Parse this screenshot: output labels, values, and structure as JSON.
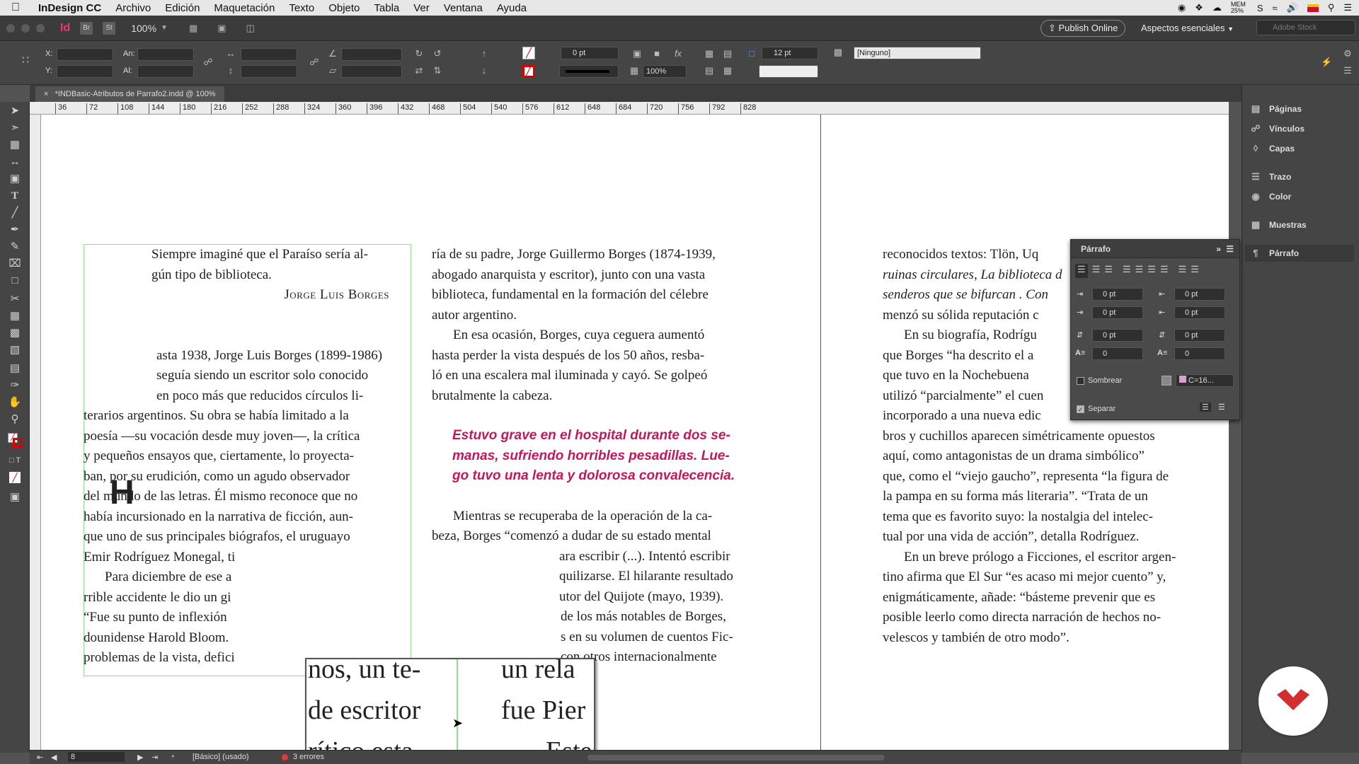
{
  "menubar": {
    "app_name": "InDesign CC",
    "items": [
      "Archivo",
      "Edición",
      "Maquetación",
      "Texto",
      "Objeto",
      "Tabla",
      "Ver",
      "Ventana",
      "Ayuda"
    ],
    "status_mem": "MEM 25%",
    "status_s": "S"
  },
  "appbar": {
    "bridge": "Br",
    "stock_label": "St",
    "zoom": "100%",
    "publish": "Publish Online",
    "workspace": "Aspectos esenciales",
    "search_placeholder": "Adobe Stock"
  },
  "control": {
    "x_label": "X:",
    "y_label": "Y:",
    "w_label": "An:",
    "h_label": "Al:",
    "stroke_weight": "0 pt",
    "scale": "100%",
    "gutter": "12 pt",
    "style": "[Ninguno]"
  },
  "document": {
    "tab_title": "*INDBasic-Atributos de Parrafo2.indd @ 100%"
  },
  "ruler": {
    "ticks": [
      "36",
      "72",
      "108",
      "144",
      "180",
      "216",
      "252",
      "288",
      "324",
      "360",
      "396",
      "432",
      "468",
      "504",
      "540",
      "576",
      "612",
      "648",
      "684",
      "720",
      "756",
      "792",
      "828"
    ]
  },
  "left_column": {
    "epigraph_1": "Siempre imaginé que el Paraíso sería al-",
    "epigraph_2": "gún tipo de biblioteca.",
    "epigraph_author": "Jorge Luis Borges",
    "drop_cap": "H",
    "lines": [
      "asta 1938, Jorge Luis Borges (1899-1986)",
      "seguía siendo un escritor solo conocido",
      "en poco más que reducidos círculos li-",
      "terarios argentinos. Su obra se había limitado a la",
      "poesía —su vocación desde muy joven—, la crítica",
      "y pequeños ensayos que, ciertamente, lo proyecta-",
      "ban, por su erudición, como un agudo observador",
      "del mundo de las letras. Él mismo reconoce que no",
      "había incursionado en la narrativa de ficción, aun-",
      "que uno de sus principales biógrafos, el uruguayo",
      "Emir Rodríguez Monegal, ti",
      "Para diciembre de ese a",
      "rrible accidente le dio un gi",
      "“Fue su punto de inflexión",
      "dounidense Harold Bloom.",
      "problemas de la vista, defici"
    ]
  },
  "middle_column": {
    "lines_1": [
      "ría de su padre, Jorge Guillermo Borges (1874-1939,",
      "abogado anarquista y escritor), junto con una vasta",
      "biblioteca, fundamental en la formación del célebre",
      "autor argentino."
    ],
    "lines_2": [
      "En esa ocasión, Borges, cuya ceguera aumentó",
      "hasta perder la vista después de los 50 años, resba-",
      "ló en una escalera mal iluminada y cayó. Se golpeó",
      "brutalmente la cabeza."
    ],
    "quote": [
      "Estuvo grave en el hospital durante dos se-",
      "manas, sufriendo horribles pesadillas. Lue-",
      "go tuvo una lenta y dolorosa convalecencia."
    ],
    "lines_3": [
      "Mientras se recuperaba de la operación de la ca-",
      "beza, Borges “comenzó a dudar de su estado mental",
      "ara escribir (...). Intentó escribir",
      "quilizarse. El hilarante resultado",
      "utor del Quijote (mayo, 1939).",
      "de los más notables de Borges,",
      "s en su volumen de cuentos Fic-",
      "con otros internacionalmente"
    ]
  },
  "right_column": {
    "lines": [
      "reconocidos textos: Tlön, Uq",
      "ruinas circulares, La biblioteca d",
      "senderos que se bifurcan . Con",
      "menzó su sólida reputación c",
      "En su biografía, Rodrígu",
      "que Borges “ha descrito el a",
      "que tuvo en la Nochebuena",
      "utilizó “parcialmente” el cuen",
      "incorporado a una nueva edic",
      "bros y cuchillos aparecen simétricamente opuestos",
      "aquí, como antagonistas de un drama simbólico”",
      "que, como el “viejo gaucho”, representa “la figura de",
      "la pampa en su forma más literaria”. “Trata de un",
      "tema que es favorito suyo: la nostalgia del intelec-",
      "tual por una vida de acción”, detalla Rodríguez.",
      "En un breve prólogo a Ficciones, el escritor argen-",
      "tino afirma que El Sur “es acaso mi mejor cuento” y,",
      "enigmáticamente, añade: “básteme prevenir que es",
      "posible leerlo como directa narración de hechos no-",
      "velescos y también de otro modo”."
    ]
  },
  "loupe": {
    "left_lines": [
      "nos, un te-",
      "de escritor",
      "rítico esta-"
    ],
    "right_lines": [
      "un rela",
      "fue Pier",
      "Este"
    ]
  },
  "dock": {
    "items": [
      "Páginas",
      "Vínculos",
      "Capas",
      "Trazo",
      "Color",
      "Muestras",
      "Párrafo"
    ]
  },
  "paragraph_panel": {
    "title": "Párrafo",
    "left_indent": "0 pt",
    "right_indent": "0 pt",
    "first_line": "0 pt",
    "last_line": "0 pt",
    "space_before": "0 pt",
    "space_after": "0 pt",
    "drop_lines": "0",
    "drop_chars": "0",
    "shading_label": "Sombrear",
    "shading_color": "C=16...",
    "hyphenate_label": "Separar"
  },
  "statusbar": {
    "page": "8",
    "profile": "[Básico] (usado)",
    "errors": "3 errores"
  },
  "colors": {
    "accent_pink": "#c2185b",
    "frame_green": "#8ee08e"
  }
}
